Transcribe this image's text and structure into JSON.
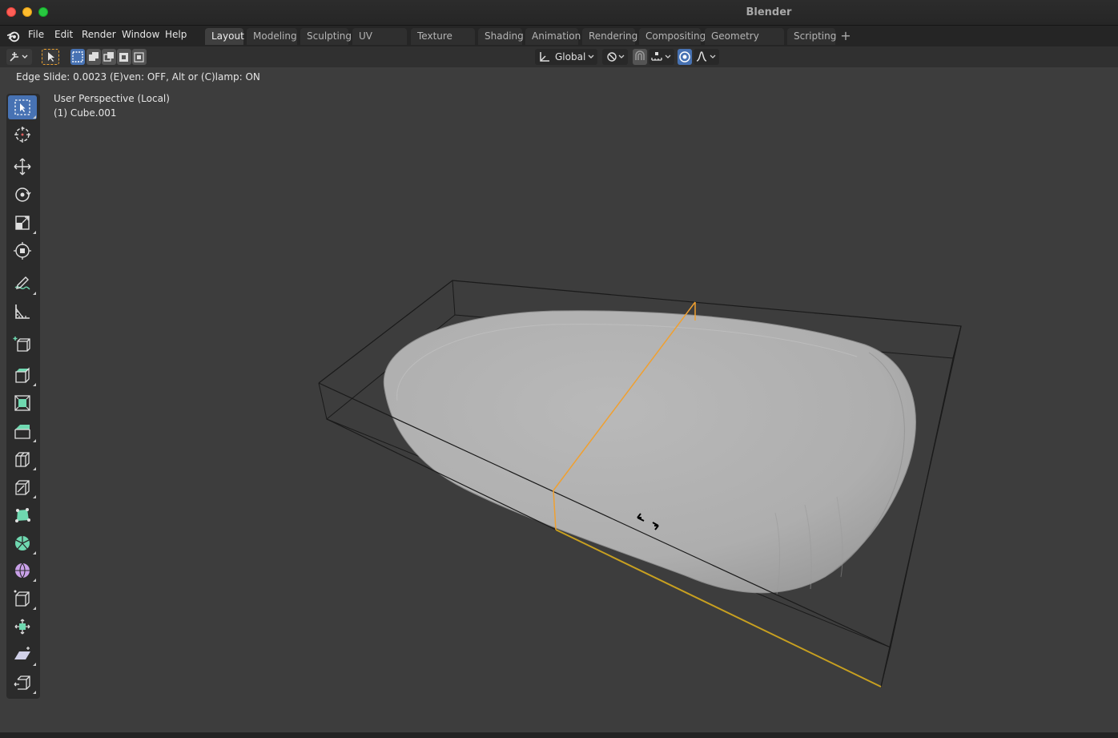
{
  "window": {
    "title": "Blender"
  },
  "menu": {
    "items": [
      "File",
      "Edit",
      "Render",
      "Window",
      "Help"
    ]
  },
  "workspaces": {
    "tabs": [
      "Layout",
      "Modeling",
      "Sculpting",
      "UV Editing",
      "Texture Paint",
      "Shading",
      "Animation",
      "Rendering",
      "Compositing",
      "Geometry Nodes",
      "Scripting"
    ],
    "active": "Layout",
    "add_label": "+"
  },
  "header": {
    "orientation": "Global"
  },
  "status": {
    "operation": "Edge Slide: 0.0023 (E)ven: OFF, Alt or (C)lamp: ON"
  },
  "viewport": {
    "perspective_label": "User Perspective (Local)",
    "object_label": "(1) Cube.001"
  },
  "toolbar": {
    "tools": [
      "select-box",
      "cursor",
      "move",
      "rotate",
      "scale",
      "transform",
      "annotate",
      "measure",
      "add-cube",
      "extrude-region",
      "inset-faces",
      "bevel",
      "loop-cut",
      "knife",
      "poly-build",
      "spin",
      "smooth",
      "edge-slide",
      "shrink-fatten",
      "shear",
      "rip-region"
    ],
    "active": "select-box"
  },
  "colors": {
    "selection": "#f0a030",
    "active_tool": "#4772b3",
    "mesh": "#b8b8b8"
  }
}
